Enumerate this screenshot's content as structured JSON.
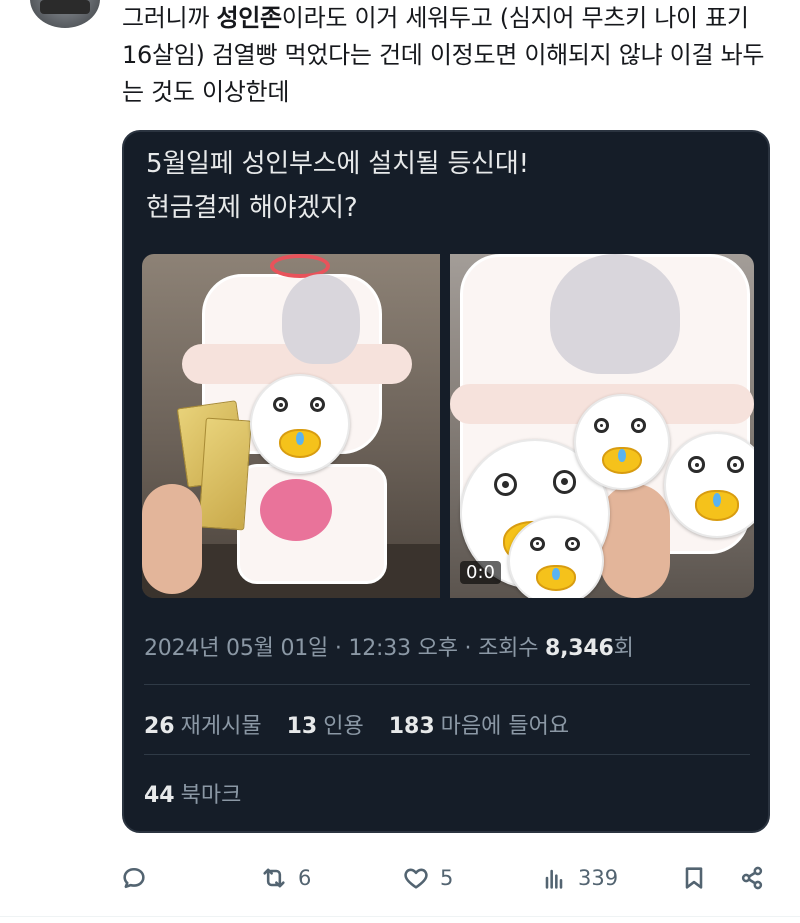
{
  "post": {
    "text_plain_1": "그러니까 ",
    "text_bold": "성인존",
    "text_plain_2": "이라도 이거 세워두고 (심지어 무츠키 나이 표기 16살임) 검열빵 먹었다는 건데 이정도면 이해되지 않냐 이걸 놔두는 것도 이상한데"
  },
  "quote": {
    "text": "5월일페 성인부스에 설치될 등신대!\n현금결제 해야겠지?",
    "video_time": "0:0",
    "meta_date": "2024년 05월 01일 · 12:33 오후 · 조회수 ",
    "views": "8,346",
    "views_suffix": "회",
    "reposts_num": "26",
    "reposts_label": "재게시물",
    "quotes_num": "13",
    "quotes_label": "인용",
    "likes_num": "183",
    "likes_label": "마음에 들어요",
    "bookmarks_num": "44",
    "bookmarks_label": "북마크"
  },
  "actions": {
    "reply_icon": "comment-icon",
    "retweet_count": "6",
    "like_count": "5",
    "views_count": "339"
  },
  "colors": {
    "card_bg": "#151d28",
    "muted": "#536471",
    "card_text": "#e7e9ea"
  }
}
